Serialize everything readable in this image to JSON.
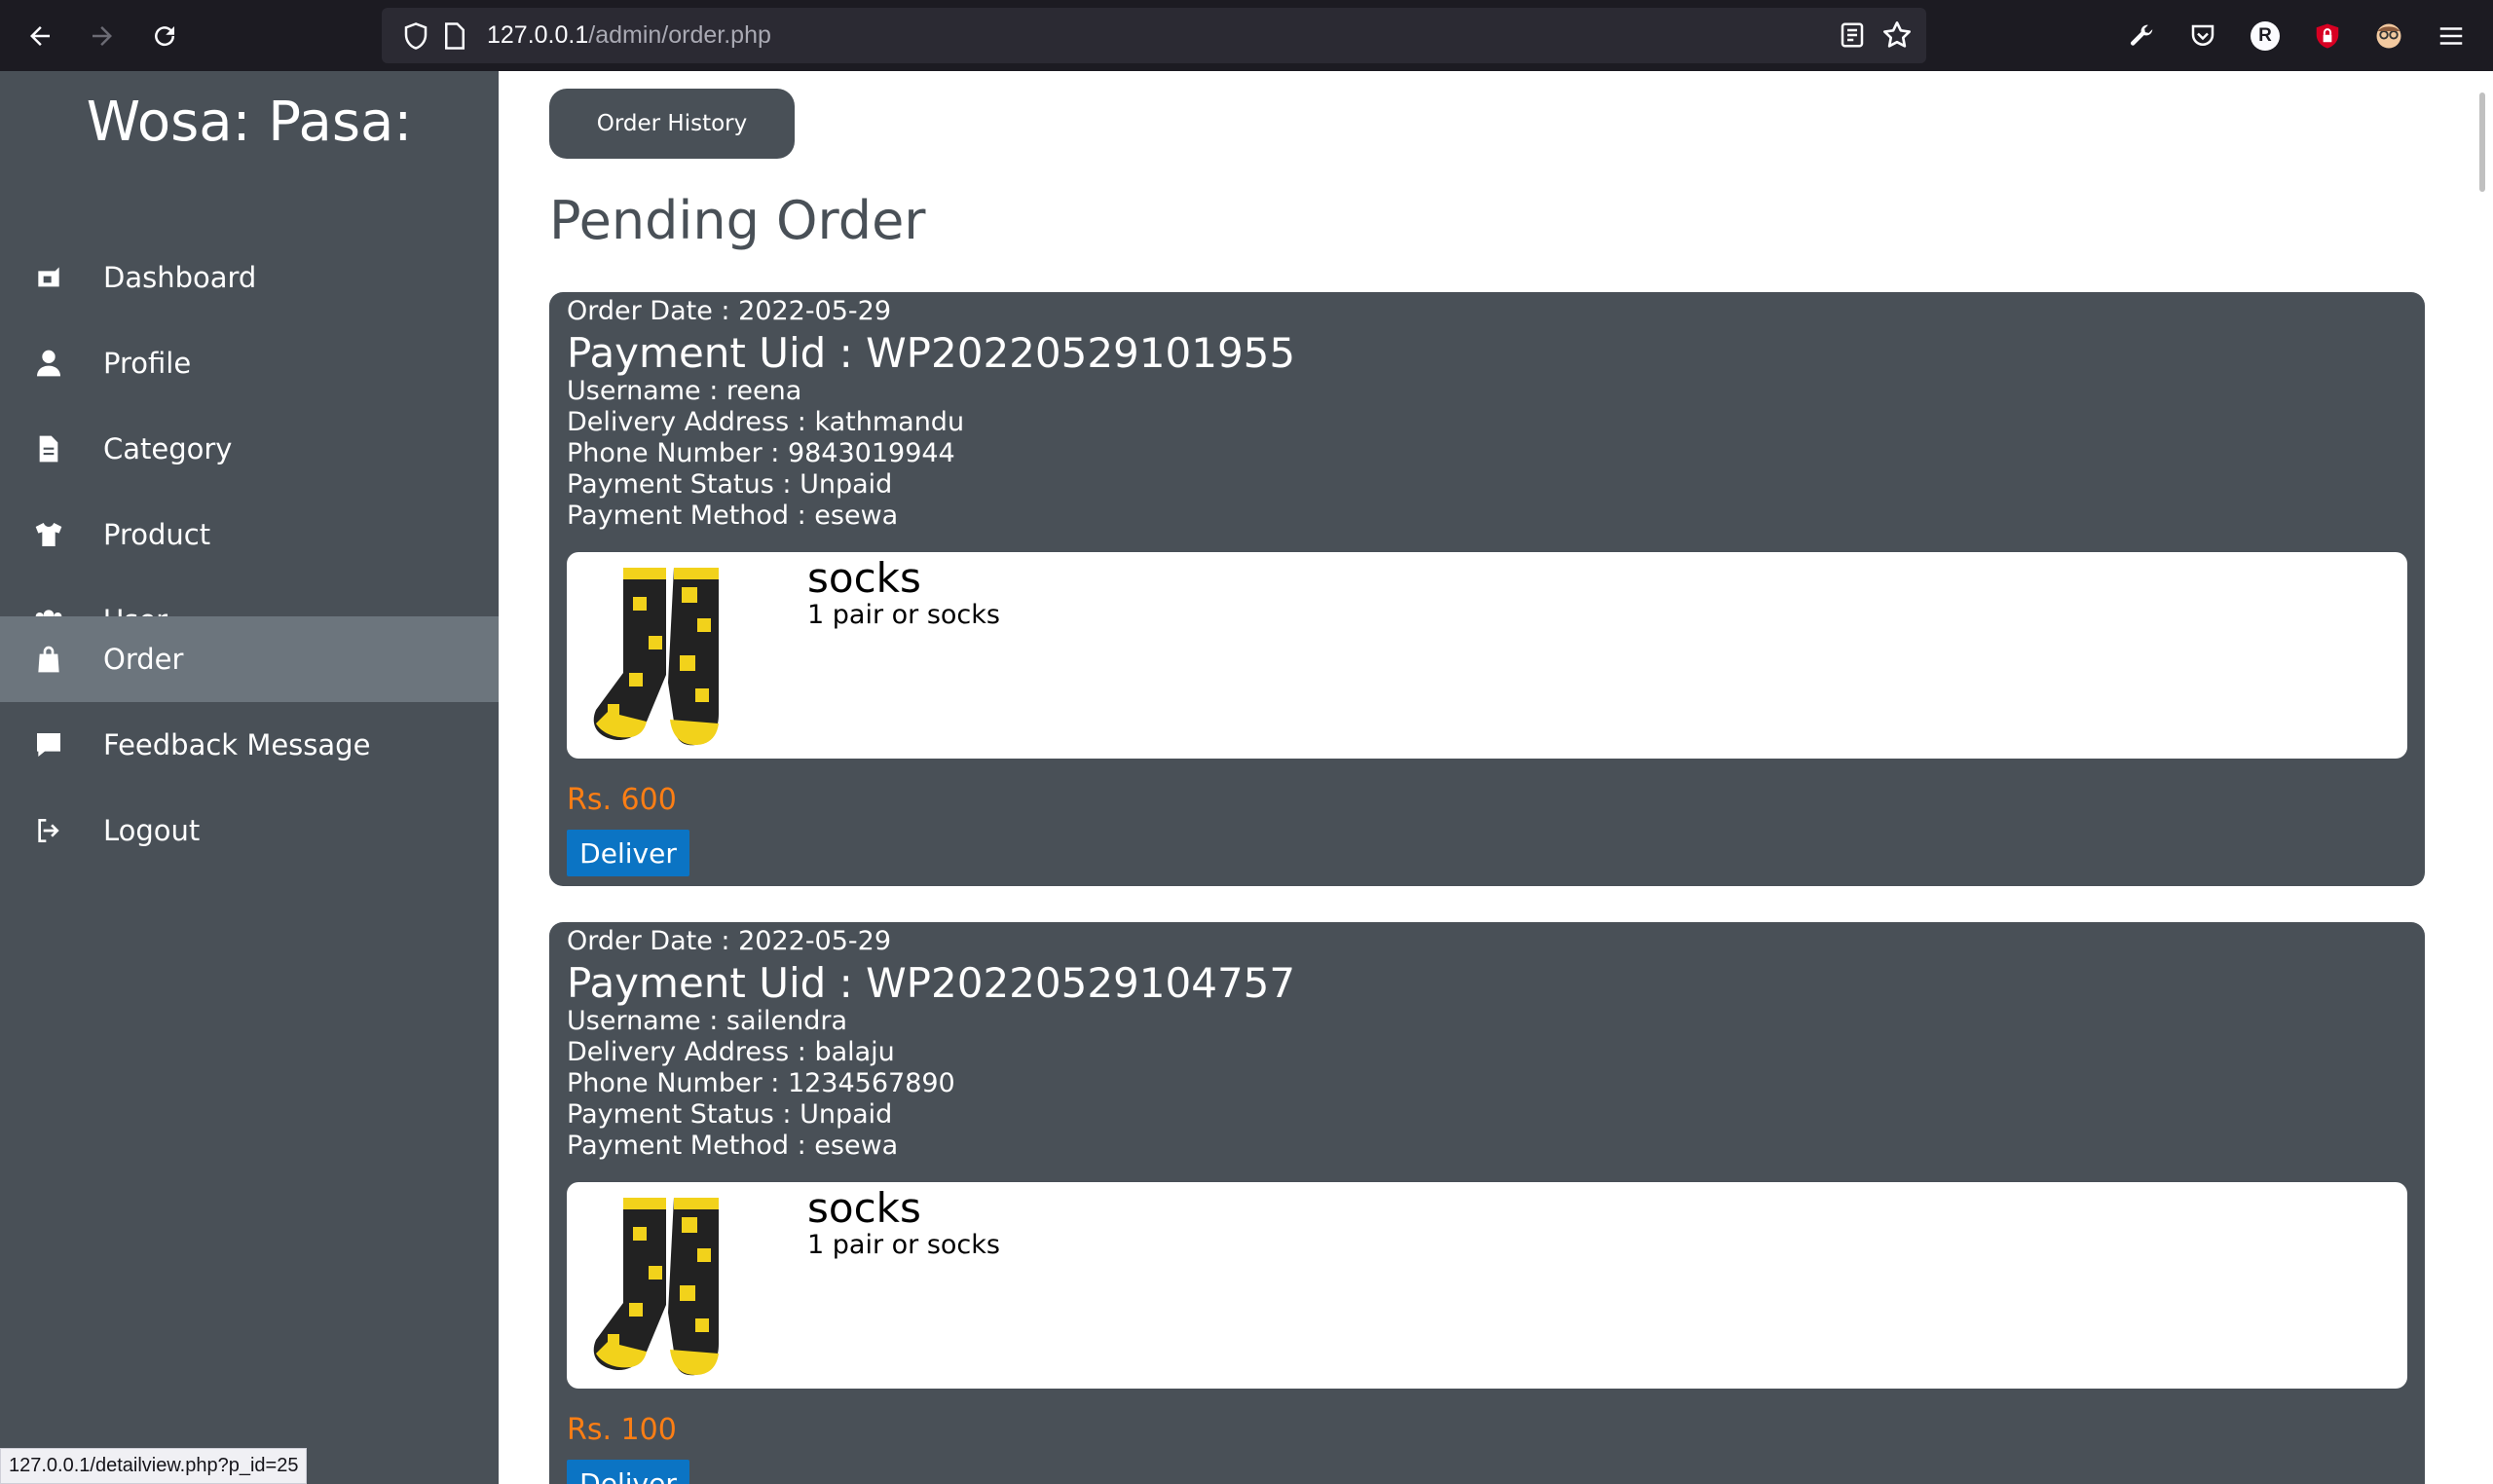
{
  "browser": {
    "url_host": "127.0.0.1",
    "url_path": "/admin/order.php",
    "status_url": "127.0.0.1/detailview.php?p_id=25",
    "profile_initial": "R"
  },
  "sidebar": {
    "brand": "Wosa: Pasa:",
    "items": [
      {
        "label": "Dashboard",
        "icon": "dashboard-icon"
      },
      {
        "label": "Profile",
        "icon": "user-icon"
      },
      {
        "label": "Category",
        "icon": "document-icon"
      },
      {
        "label": "Product",
        "icon": "shirt-icon"
      },
      {
        "label": "User",
        "icon": "users-icon"
      },
      {
        "label": "Order",
        "icon": "bag-icon"
      },
      {
        "label": "Feedback Message",
        "icon": "message-icon"
      },
      {
        "label": "Logout",
        "icon": "logout-icon"
      }
    ],
    "active": "Order"
  },
  "main": {
    "history_button": "Order History",
    "title": "Pending Order",
    "orders": [
      {
        "date": "Order Date : 2022-05-29",
        "uid": "Payment Uid : WP20220529101955",
        "username": "Username : reena",
        "address": "Delivery Address : kathmandu",
        "phone": "Phone Number : 9843019944",
        "status": "Payment Status : Unpaid",
        "method": "Payment Method : esewa",
        "product_name": "socks",
        "product_desc": "1 pair or socks",
        "price": "Rs. 600",
        "deliver": "Deliver"
      },
      {
        "date": "Order Date : 2022-05-29",
        "uid": "Payment Uid : WP20220529104757",
        "username": "Username : sailendra",
        "address": "Delivery Address : balaju",
        "phone": "Phone Number : 1234567890",
        "status": "Payment Status : Unpaid",
        "method": "Payment Method : esewa",
        "product_name": "socks",
        "product_desc": "1 pair or socks",
        "price": "Rs. 100",
        "deliver": "Deliver"
      }
    ]
  },
  "colors": {
    "sidebar_bg": "#495057",
    "active_bg": "#6c757d",
    "price": "#fd7e14",
    "deliver": "#0b74c4"
  }
}
